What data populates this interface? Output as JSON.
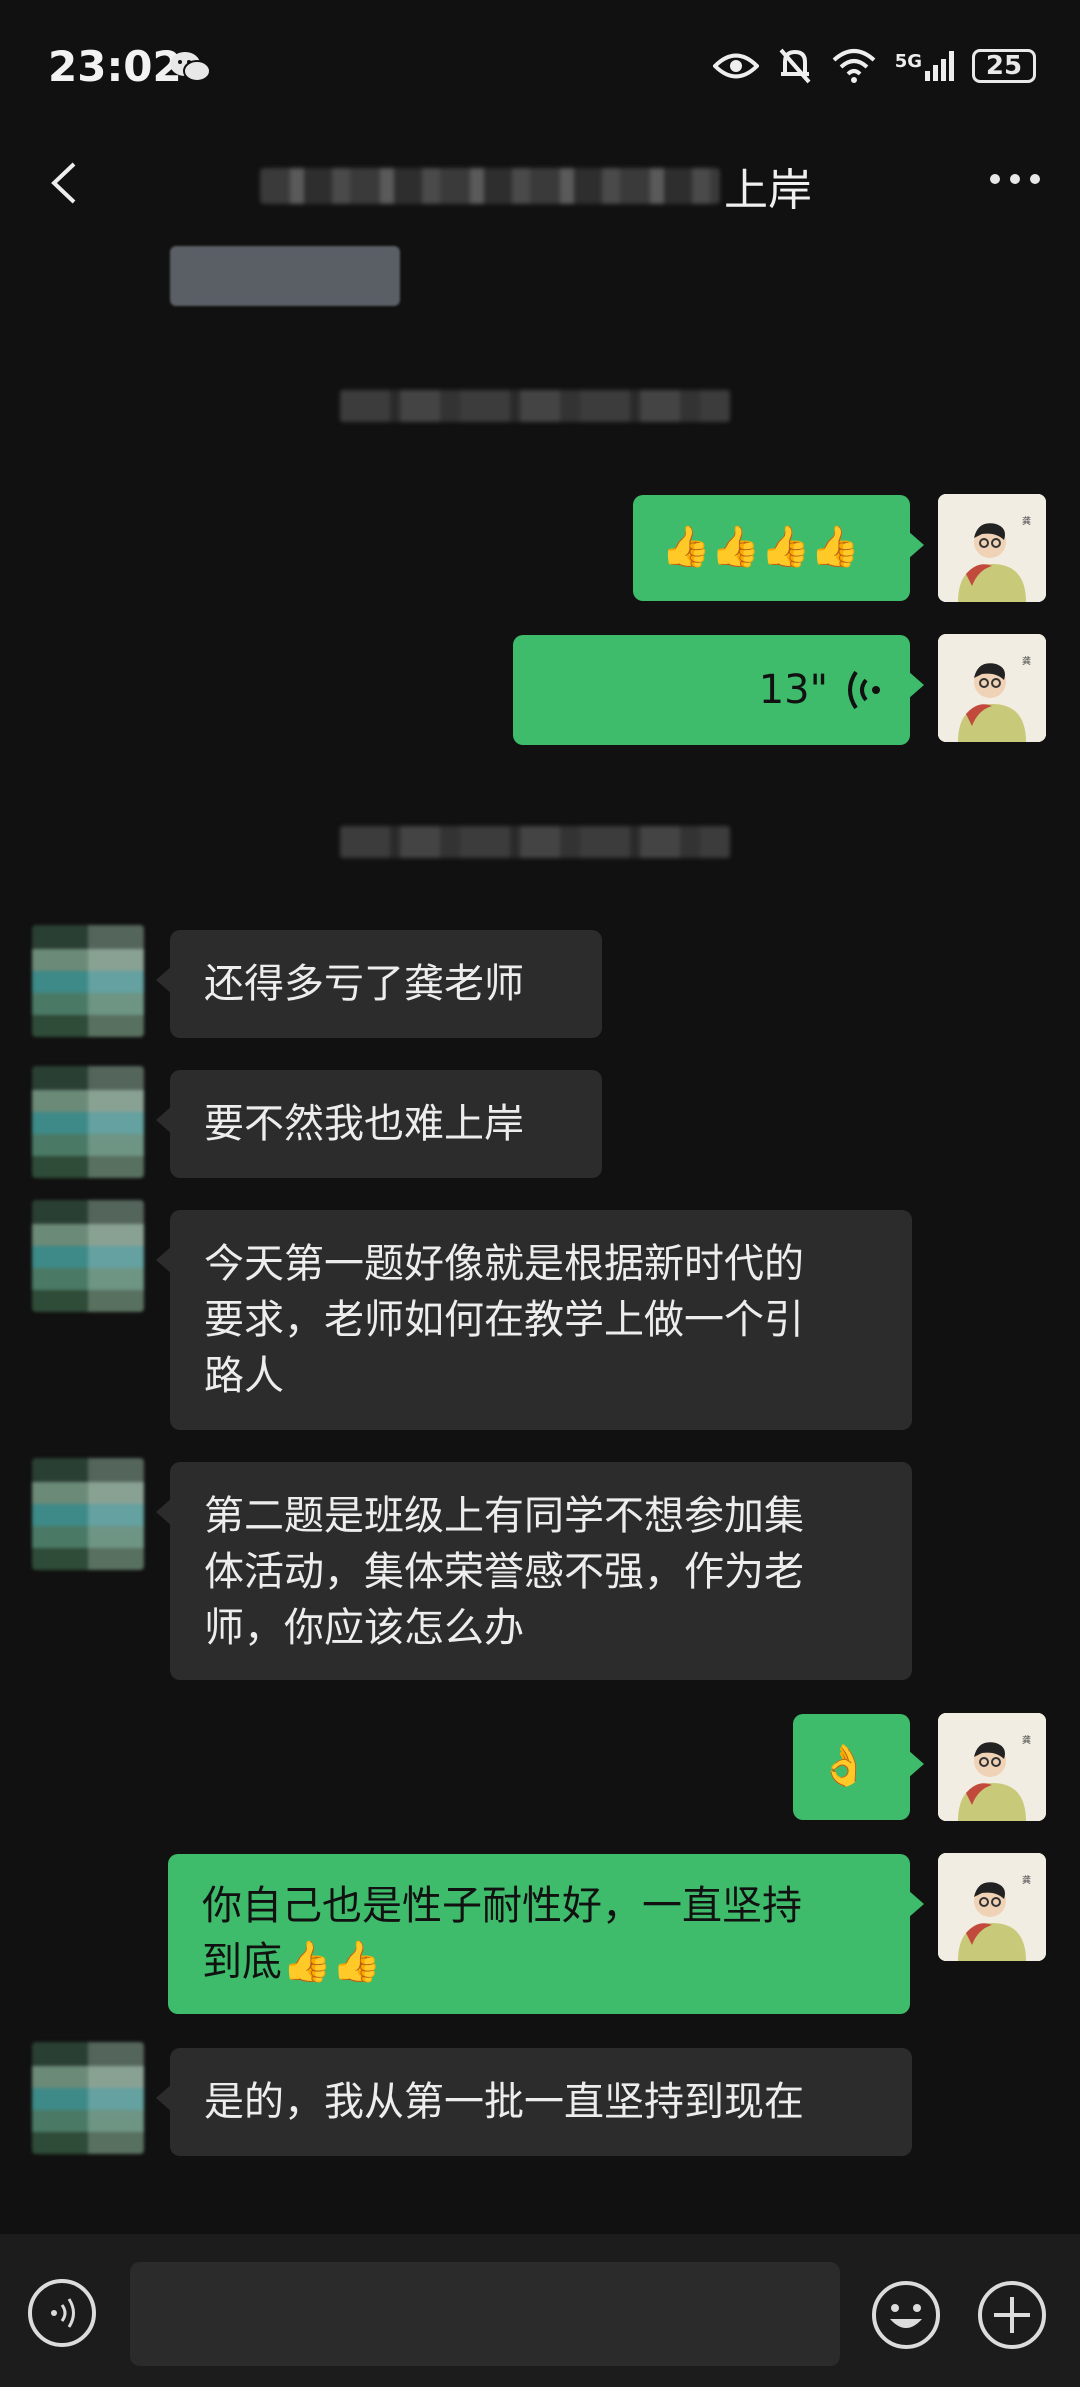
{
  "status": {
    "time": "23:02",
    "battery": "25",
    "network": "5G"
  },
  "nav": {
    "title_visible": "上岸"
  },
  "messages": [
    {
      "side": "me",
      "type": "emoji",
      "text": "👍👍👍👍"
    },
    {
      "side": "me",
      "type": "voice",
      "duration": "13\""
    },
    {
      "side": "other",
      "type": "text",
      "text": "还得多亏了龚老师"
    },
    {
      "side": "other",
      "type": "text",
      "text": "要不然我也难上岸"
    },
    {
      "side": "other",
      "type": "text",
      "lines": [
        "今天第一题好像就是根据新时代的",
        "要求，老师如何在教学上做一个引",
        "路人"
      ]
    },
    {
      "side": "other",
      "type": "text",
      "lines": [
        "第二题是班级上有同学不想参加集",
        "体活动，集体荣誉感不强，作为老",
        "师，你应该怎么办"
      ]
    },
    {
      "side": "me",
      "type": "emoji",
      "text": "👌"
    },
    {
      "side": "me",
      "type": "text",
      "lines": [
        "你自己也是性子耐性好，一直坚持",
        "到底👍👍"
      ]
    },
    {
      "side": "other",
      "type": "text",
      "text": "是的，我从第一批一直坚持到现在"
    }
  ],
  "colors": {
    "green": "#3ebb6b",
    "bubble_gray": "#2c2c2c",
    "background": "#111111"
  }
}
